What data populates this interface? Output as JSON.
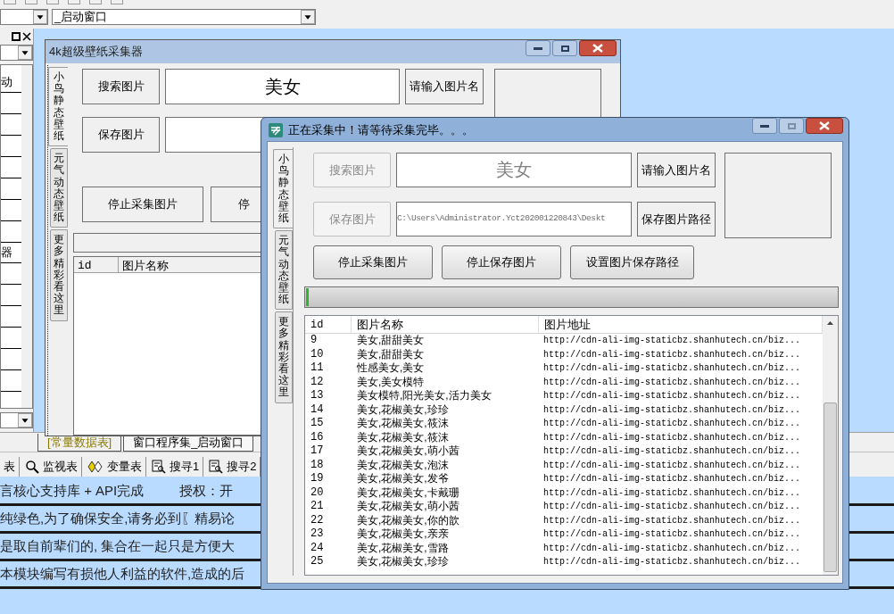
{
  "ide": {
    "form_selector": {
      "value": "_启动窗口"
    },
    "left_panel": {
      "items": [
        {
          "label": "动"
        },
        {
          "label": "器"
        }
      ]
    },
    "design_form": {
      "title": "4k超级壁纸采集器",
      "side_tabs": [
        {
          "label": "小鸟静态壁纸",
          "selected": true
        },
        {
          "label": "元气动态壁纸",
          "selected": false
        },
        {
          "label": "更多精彩看这里",
          "selected": false
        }
      ],
      "search_button": "搜索图片",
      "keyword": "美女",
      "name_button": "请输入图片名",
      "save_button": "保存图片",
      "stop_collect_button": "停止采集图片",
      "stop_save_button": "停",
      "columns": [
        "id",
        "图片名称"
      ]
    },
    "doc_tabs": [
      {
        "label": "[常量数据表]",
        "selected": true
      },
      {
        "label": "窗口程序集_启动窗口",
        "selected": false
      }
    ],
    "panel_tabs": [
      {
        "label": "表",
        "kind": "plain"
      },
      {
        "label": "监视表",
        "kind": "watch"
      },
      {
        "label": "变量表",
        "kind": "variable"
      },
      {
        "label": "搜寻1",
        "kind": "find"
      },
      {
        "label": "搜寻2",
        "kind": "find"
      }
    ],
    "output_lines": [
      {
        "text": "言核心支持库 + API完成",
        "extra": "授权：开"
      },
      {
        "text": "纯绿色,为了确保安全,请务必到〖精易论"
      },
      {
        "text": "是取自前辈们的, 集合在一起只是方便大"
      },
      {
        "text": "本模块编写有损他人利益的软件,造成的后"
      }
    ]
  },
  "dialog": {
    "title": "正在采集中！请等待采集完毕。。。",
    "side_tabs": [
      {
        "label": "小鸟静态壁纸",
        "selected": true
      },
      {
        "label": "元气动态壁纸",
        "selected": false
      },
      {
        "label": "更多精彩看这里",
        "selected": false
      }
    ],
    "search_button": {
      "label": "搜索图片",
      "disabled": true
    },
    "keyword": {
      "value": "美女",
      "disabled": true
    },
    "name_button": {
      "label": "请输入图片名",
      "disabled": false
    },
    "save_button": {
      "label": "保存图片",
      "disabled": true
    },
    "path": {
      "value": "C:\\Users\\Administrator.Yct202001220843\\Deskt",
      "disabled": true
    },
    "path_button": {
      "label": "保存图片路径",
      "disabled": false
    },
    "actions": [
      "停止采集图片",
      "停止保存图片",
      "设置图片保存路径"
    ],
    "progress": {
      "level": 0.005
    },
    "table": {
      "columns": [
        "id",
        "图片名称",
        "图片地址"
      ],
      "rows": [
        [
          "9",
          "美女,甜甜美女",
          "http://cdn-ali-img-staticbz.shanhutech.cn/biz..."
        ],
        [
          "10",
          "美女,甜甜美女",
          "http://cdn-ali-img-staticbz.shanhutech.cn/biz..."
        ],
        [
          "11",
          "性感美女,美女",
          "http://cdn-ali-img-staticbz.shanhutech.cn/biz..."
        ],
        [
          "12",
          "美女,美女模特",
          "http://cdn-ali-img-staticbz.shanhutech.cn/biz..."
        ],
        [
          "13",
          "美女模特,阳光美女,活力美女",
          "http://cdn-ali-img-staticbz.shanhutech.cn/biz..."
        ],
        [
          "14",
          "美女,花椒美女,珍珍",
          "http://cdn-ali-img-staticbz.shanhutech.cn/biz..."
        ],
        [
          "15",
          "美女,花椒美女,筱沫",
          "http://cdn-ali-img-staticbz.shanhutech.cn/biz..."
        ],
        [
          "16",
          "美女,花椒美女,筱沫",
          "http://cdn-ali-img-staticbz.shanhutech.cn/biz..."
        ],
        [
          "17",
          "美女,花椒美女,萌小茜",
          "http://cdn-ali-img-staticbz.shanhutech.cn/biz..."
        ],
        [
          "18",
          "美女,花椒美女,泡沫",
          "http://cdn-ali-img-staticbz.shanhutech.cn/biz..."
        ],
        [
          "19",
          "美女,花椒美女,发爷",
          "http://cdn-ali-img-staticbz.shanhutech.cn/biz..."
        ],
        [
          "20",
          "美女,花椒美女,卡戴珊",
          "http://cdn-ali-img-staticbz.shanhutech.cn/biz..."
        ],
        [
          "21",
          "美女,花椒美女,萌小茜",
          "http://cdn-ali-img-staticbz.shanhutech.cn/biz..."
        ],
        [
          "22",
          "美女,花椒美女,你的歆",
          "http://cdn-ali-img-staticbz.shanhutech.cn/biz..."
        ],
        [
          "23",
          "美女,花椒美女,亲亲",
          "http://cdn-ali-img-staticbz.shanhutech.cn/biz..."
        ],
        [
          "24",
          "美女,花椒美女,雪路",
          "http://cdn-ali-img-staticbz.shanhutech.cn/biz..."
        ],
        [
          "25",
          "美女,花椒美女,珍珍",
          "http://cdn-ali-img-staticbz.shanhutech.cn/biz..."
        ]
      ]
    }
  }
}
